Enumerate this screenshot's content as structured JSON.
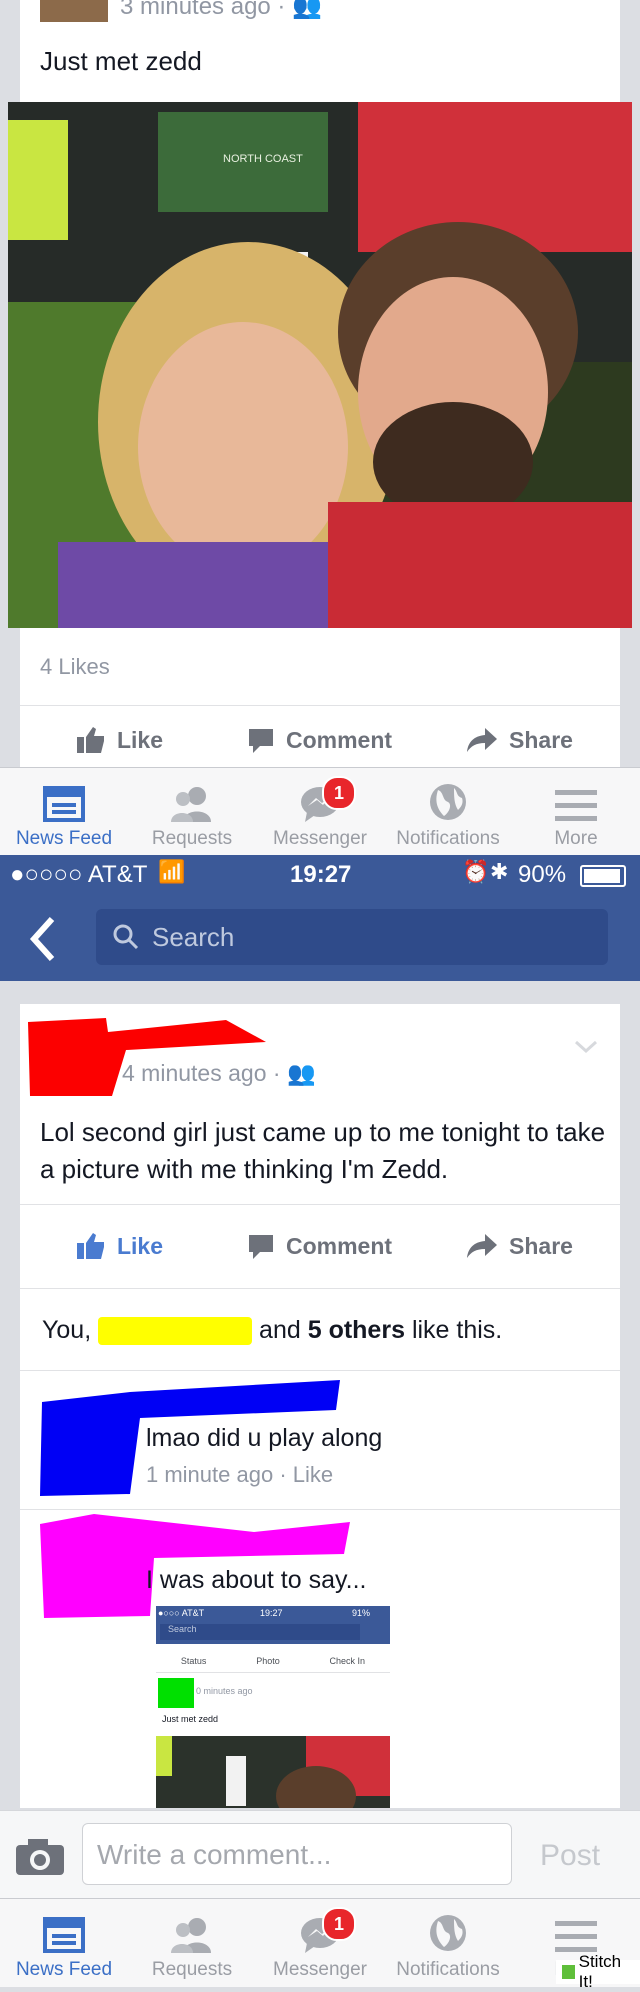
{
  "top_post": {
    "timestamp": "3 minutes ago",
    "text": "Just met zedd",
    "likes": "4 Likes",
    "photo_banner": "NORTH COAST"
  },
  "actions": {
    "like": "Like",
    "comment": "Comment",
    "share": "Share"
  },
  "tabbar": {
    "news_feed": "News Feed",
    "requests": "Requests",
    "messenger": "Messenger",
    "notifications": "Notifications",
    "more": "More",
    "badge": "1"
  },
  "statusbar": {
    "carrier": "●○○○○ AT&T",
    "time": "19:27",
    "battery": "90%"
  },
  "search": {
    "placeholder": "Search"
  },
  "post": {
    "timestamp": "4 minutes ago",
    "text": "Lol second girl just came up to me tonight to take a picture with me thinking I'm Zedd.",
    "like": "Like",
    "likes_you": "You,",
    "likes_and": "and",
    "likes_others": "5 others",
    "likes_tail": "like this."
  },
  "comments": [
    {
      "text": "lmao did u play along",
      "meta": "1 minute ago",
      "like": "Like"
    },
    {
      "text": "I was about to say..."
    }
  ],
  "embedded": {
    "carrier": "●○○○ AT&T",
    "time": "19:27",
    "battery": "91%",
    "search": "Search",
    "status": "Status",
    "photo": "Photo",
    "checkin": "Check In",
    "timestamp": "0 minutes ago",
    "text": "Just met zedd"
  },
  "composer": {
    "placeholder": "Write a comment...",
    "post": "Post"
  },
  "watermark": "Stitch It!"
}
